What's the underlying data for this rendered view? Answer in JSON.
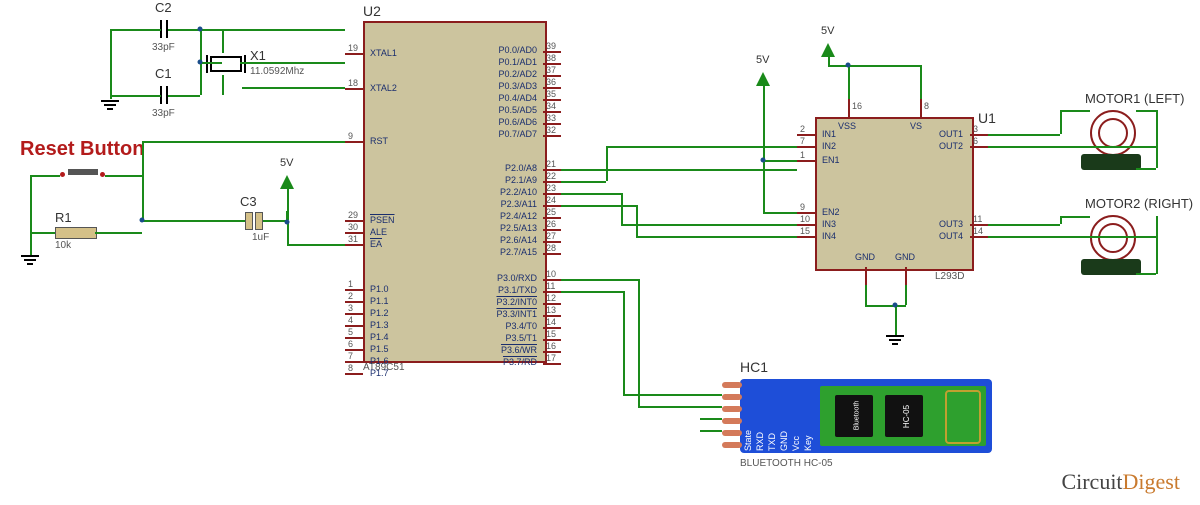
{
  "circuit": {
    "reset_label": "Reset Button",
    "logo_part1": "Circuit",
    "logo_part2": "Digest"
  },
  "components": {
    "C1": {
      "ref": "C1",
      "value": "33pF"
    },
    "C2": {
      "ref": "C2",
      "value": "33pF"
    },
    "C3": {
      "ref": "C3",
      "value": "1uF"
    },
    "X1": {
      "ref": "X1",
      "value": "11.0592Mhz"
    },
    "R1": {
      "ref": "R1",
      "value": "10k"
    },
    "U1": {
      "ref": "U1",
      "value": "L293D"
    },
    "U2": {
      "ref": "U2",
      "value": "AT89C51"
    },
    "HC1": {
      "ref": "HC1",
      "value": "BLUETOOTH HC-05"
    },
    "HC05chip": "HC-05",
    "BTchip": "Bluetooth",
    "M1": {
      "ref": "MOTOR1 (LEFT)"
    },
    "M2": {
      "ref": "MOTOR2 (RIGHT)"
    }
  },
  "u2_pins_left": [
    {
      "num": "19",
      "name": "XTAL1"
    },
    {
      "num": "18",
      "name": "XTAL2"
    },
    {
      "num": "9",
      "name": "RST"
    },
    {
      "num": "29",
      "name": "PSEN",
      "over": true
    },
    {
      "num": "30",
      "name": "ALE"
    },
    {
      "num": "31",
      "name": "EA",
      "over": true
    },
    {
      "num": "1",
      "name": "P1.0"
    },
    {
      "num": "2",
      "name": "P1.1"
    },
    {
      "num": "3",
      "name": "P1.2"
    },
    {
      "num": "4",
      "name": "P1.3"
    },
    {
      "num": "5",
      "name": "P1.4"
    },
    {
      "num": "6",
      "name": "P1.5"
    },
    {
      "num": "7",
      "name": "P1.6"
    },
    {
      "num": "8",
      "name": "P1.7"
    }
  ],
  "u2_pins_right": [
    {
      "num": "39",
      "name": "P0.0/AD0"
    },
    {
      "num": "38",
      "name": "P0.1/AD1"
    },
    {
      "num": "37",
      "name": "P0.2/AD2"
    },
    {
      "num": "36",
      "name": "P0.3/AD3"
    },
    {
      "num": "35",
      "name": "P0.4/AD4"
    },
    {
      "num": "34",
      "name": "P0.5/AD5"
    },
    {
      "num": "33",
      "name": "P0.6/AD6"
    },
    {
      "num": "32",
      "name": "P0.7/AD7"
    },
    {
      "num": "21",
      "name": "P2.0/A8"
    },
    {
      "num": "22",
      "name": "P2.1/A9"
    },
    {
      "num": "23",
      "name": "P2.2/A10"
    },
    {
      "num": "24",
      "name": "P2.3/A11"
    },
    {
      "num": "25",
      "name": "P2.4/A12"
    },
    {
      "num": "26",
      "name": "P2.5/A13"
    },
    {
      "num": "27",
      "name": "P2.6/A14"
    },
    {
      "num": "28",
      "name": "P2.7/A15"
    },
    {
      "num": "10",
      "name": "P3.0/RXD"
    },
    {
      "num": "11",
      "name": "P3.1/TXD"
    },
    {
      "num": "12",
      "name": "P3.2/INT0",
      "over": true
    },
    {
      "num": "13",
      "name": "P3.3/INT1",
      "over": true
    },
    {
      "num": "14",
      "name": "P3.4/T0"
    },
    {
      "num": "15",
      "name": "P3.5/T1"
    },
    {
      "num": "16",
      "name": "P3.6/WR",
      "over": true
    },
    {
      "num": "17",
      "name": "P3.7/RD",
      "over": true
    }
  ],
  "u1_pins_left": [
    {
      "num": "2",
      "name": "IN1"
    },
    {
      "num": "7",
      "name": "IN2"
    },
    {
      "num": "1",
      "name": "EN1"
    },
    {
      "num": "9",
      "name": "EN2"
    },
    {
      "num": "10",
      "name": "IN3"
    },
    {
      "num": "15",
      "name": "IN4"
    }
  ],
  "u1_pins_right": [
    {
      "num": "3",
      "name": "OUT1"
    },
    {
      "num": "6",
      "name": "OUT2"
    },
    {
      "num": "11",
      "name": "OUT3"
    },
    {
      "num": "14",
      "name": "OUT4"
    }
  ],
  "u1_pins_top": [
    {
      "num": "16",
      "name": "VSS"
    },
    {
      "num": "8",
      "name": "VS"
    }
  ],
  "u1_pins_bot": [
    {
      "name": "GND"
    },
    {
      "name": "GND"
    }
  ],
  "bt_pins": [
    "State",
    "RXD",
    "TXD",
    "GND",
    "Vcc",
    "Key"
  ]
}
